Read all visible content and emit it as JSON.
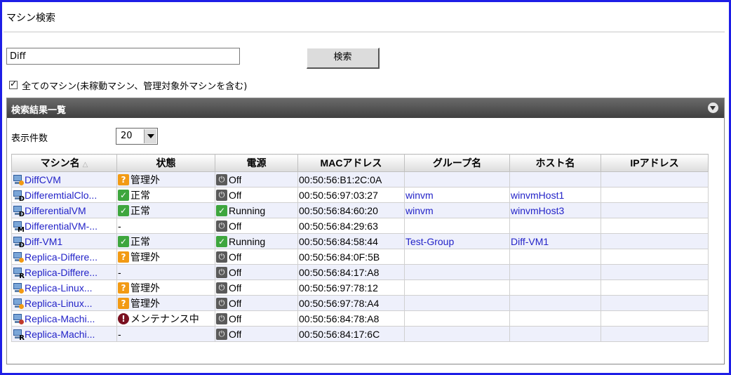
{
  "page_title": "マシン検索",
  "search": {
    "value": "Diff",
    "button_label": "検索"
  },
  "all_machines": {
    "checked": true,
    "label": "全てのマシン(未稼動マシン、管理対象外マシンを含む)"
  },
  "panel": {
    "title": "検索結果一覧",
    "per_page_label": "表示件数",
    "per_page_value": "20"
  },
  "table": {
    "sorted_column": "マシン名",
    "sort_arrow": "△",
    "columns": [
      {
        "label": "マシン名"
      },
      {
        "label": "状態"
      },
      {
        "label": "電源"
      },
      {
        "label": "MACアドレス"
      },
      {
        "label": "グループ名"
      },
      {
        "label": "ホスト名"
      },
      {
        "label": "IPアドレス"
      }
    ],
    "rows": [
      {
        "name": "DiffCVM",
        "icon_badge": "dot",
        "status": "管理外",
        "status_icon": "warn",
        "power": "Off",
        "mac": "00:50:56:B1:2C:0A",
        "group": "",
        "host": "",
        "ip": ""
      },
      {
        "name": "DifferemtialClo...",
        "icon_badge": "D",
        "status": "正常",
        "status_icon": "ok",
        "power": "Off",
        "mac": "00:50:56:97:03:27",
        "group": "winvm",
        "host": "winvmHost1",
        "ip": ""
      },
      {
        "name": "DifferentialVM",
        "icon_badge": "D",
        "status": "正常",
        "status_icon": "ok",
        "power": "Running",
        "mac": "00:50:56:84:60:20",
        "group": "winvm",
        "host": "winvmHost3",
        "ip": ""
      },
      {
        "name": "DifferentialVM-...",
        "icon_badge": "M",
        "status": "-",
        "status_icon": "",
        "power": "Off",
        "mac": "00:50:56:84:29:63",
        "group": "",
        "host": "",
        "ip": ""
      },
      {
        "name": "Diff-VM1",
        "icon_badge": "D",
        "status": "正常",
        "status_icon": "ok",
        "power": "Running",
        "mac": "00:50:56:84:58:44",
        "group": "Test-Group",
        "host": "Diff-VM1",
        "ip": ""
      },
      {
        "name": "Replica-Differe...",
        "icon_badge": "dot",
        "status": "管理外",
        "status_icon": "warn",
        "power": "Off",
        "mac": "00:50:56:84:0F:5B",
        "group": "",
        "host": "",
        "ip": ""
      },
      {
        "name": "Replica-Differe...",
        "icon_badge": "R",
        "status": "-",
        "status_icon": "",
        "power": "Off",
        "mac": "00:50:56:84:17:A8",
        "group": "",
        "host": "",
        "ip": ""
      },
      {
        "name": "Replica-Linux...",
        "icon_badge": "dot",
        "status": "管理外",
        "status_icon": "warn",
        "power": "Off",
        "mac": "00:50:56:97:78:12",
        "group": "",
        "host": "",
        "ip": ""
      },
      {
        "name": "Replica-Linux...",
        "icon_badge": "dot",
        "status": "管理外",
        "status_icon": "warn",
        "power": "Off",
        "mac": "00:50:56:97:78:A4",
        "group": "",
        "host": "",
        "ip": ""
      },
      {
        "name": "Replica-Machi...",
        "icon_badge": "reddot",
        "status": "メンテナンス中",
        "status_icon": "maint",
        "power": "Off",
        "mac": "00:50:56:84:78:A8",
        "group": "",
        "host": "",
        "ip": ""
      },
      {
        "name": "Replica-Machi...",
        "icon_badge": "R",
        "status": "-",
        "status_icon": "",
        "power": "Off",
        "mac": "00:50:56:84:17:6C",
        "group": "",
        "host": "",
        "ip": ""
      }
    ]
  },
  "colors": {
    "frame": "#1e1ee6",
    "link": "#2323c8",
    "warn": "#f29a14",
    "ok": "#3ea63e",
    "maintenance": "#7a1020",
    "header_bar": "#4a4a4a"
  },
  "icons": {
    "vm": "virtual-machine-icon",
    "warn": "warning-icon",
    "ok": "ok-check-icon",
    "maint": "maintenance-icon",
    "power_off": "power-off-icon",
    "running": "running-check-icon",
    "collapse": "collapse-triangle-icon",
    "dropdown": "chevron-down-icon"
  }
}
